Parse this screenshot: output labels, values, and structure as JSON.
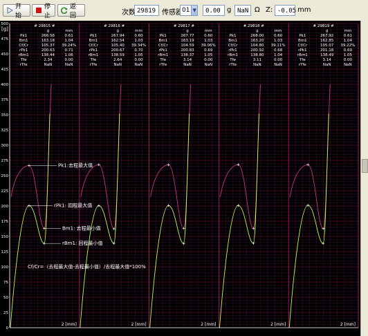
{
  "toolbar": {
    "start_label": "开始",
    "stop_label": "停止",
    "back_label": "返回",
    "count_label": "次数",
    "count_value": "29819",
    "sensor_label": "传感器",
    "sensor_value": "01",
    "force_value": "0.00",
    "force_unit": "g",
    "res_value": "NaN",
    "res_unit": "Ω",
    "z_label": "Z:",
    "z_value": "-0.05",
    "z_unit": "mm"
  },
  "axis": {
    "ylabel": "[g]",
    "yticks": [
      500,
      475,
      450,
      425,
      400,
      375,
      350,
      325,
      300,
      275,
      250,
      225,
      200,
      175,
      150,
      125,
      100,
      75,
      50,
      25,
      0
    ],
    "xlabel": "2 [mm]"
  },
  "panels": [
    {
      "id": "# 29815 #",
      "rows": [
        [
          "Pk1",
          "266.56",
          "0.61"
        ],
        [
          "Bm1",
          "163.18",
          "1.04"
        ],
        [
          "Cf/Cr",
          "105.37",
          "39.24%"
        ],
        [
          "rPk1",
          "200.63",
          "0.71"
        ],
        [
          "rBm1",
          "138.44",
          "1.06"
        ],
        [
          "Tfe",
          "2.34",
          "0.00"
        ],
        [
          "rTfe",
          "NaN",
          "NaN"
        ]
      ]
    },
    {
      "id": "# 29816 #",
      "rows": [
        [
          "Pk1",
          "267.94",
          "0.60"
        ],
        [
          "Bm1",
          "162.54",
          "1.03"
        ],
        [
          "Cf/Cr",
          "105.40",
          "39.34%"
        ],
        [
          "rPk1",
          "200.67",
          "0.70"
        ],
        [
          "rBm1",
          "138.59",
          "1.05"
        ],
        [
          "Tfe",
          "2.64",
          "0.00"
        ],
        [
          "rTfe",
          "NaN",
          "NaN"
        ]
      ]
    },
    {
      "id": "# 29817 #",
      "rows": [
        [
          "Pk1",
          "267.77",
          "0.60"
        ],
        [
          "Bm1",
          "163.19",
          "1.03"
        ],
        [
          "Cf/Cr",
          "104.59",
          "39.06%"
        ],
        [
          "rPk1",
          "200.83",
          "0.69"
        ],
        [
          "rBm1",
          "138.37",
          "1.05"
        ],
        [
          "Tfe",
          "3.14",
          "0.00"
        ],
        [
          "rTfe",
          "NaN",
          "NaN"
        ]
      ]
    },
    {
      "id": "# 29818 #",
      "rows": [
        [
          "Pk1",
          "268.00",
          "0.60"
        ],
        [
          "Bm1",
          "163.20",
          "1.03"
        ],
        [
          "Cf/Cr",
          "104.80",
          "39.11%"
        ],
        [
          "rPk1",
          "200.92",
          "0.68"
        ],
        [
          "rBm1",
          "138.80",
          "1.04"
        ],
        [
          "Tfe",
          "3.11",
          "0.00"
        ],
        [
          "rTfe",
          "NaN",
          "NaN"
        ]
      ]
    },
    {
      "id": "# 29819 #",
      "rows": [
        [
          "Pk1",
          "267.92",
          "0.61"
        ],
        [
          "Bm1",
          "162.85",
          "1.04"
        ],
        [
          "Cf/Cr",
          "105.07",
          "39.22%"
        ],
        [
          "rPk1",
          "201.18",
          "0.69"
        ],
        [
          "rBm1",
          "138.49",
          "1.05"
        ],
        [
          "Tfe",
          "3.14",
          "0.00"
        ],
        [
          "rTfe",
          "NaN",
          "NaN"
        ]
      ]
    }
  ],
  "stats_header": {
    "g": "g",
    "mm": "mm"
  },
  "annotations": {
    "pk": "Pk1:去程最大值",
    "rpk": "rPk1: 回程最大值",
    "bm": "Bm1: 去程最小值",
    "rbm": "rBm1: 回程最小值",
    "formula": "Cf/Cr=（去程最大值-去程最小值）/去程最大值*100%"
  },
  "colors": {
    "background": "#000000",
    "grid_major": "#c0196a",
    "grid_minor": "#3a1030",
    "forward_curve": "#c0387a",
    "return_curve": "#b8ff50",
    "text": "#ffffff"
  },
  "chart_data": {
    "type": "line",
    "ylabel": "[g]",
    "xlabel": "2 [mm]",
    "ylim": [
      0,
      500
    ],
    "series": [
      {
        "values": [
          266.56,
          163.18,
          200.63,
          138.44
        ]
      },
      {
        "values": [
          267.94,
          162.54,
          200.67,
          138.59
        ]
      },
      {
        "values": [
          267.77,
          163.19,
          200.83,
          138.37
        ]
      },
      {
        "values": [
          268.0,
          163.2,
          200.92,
          138.8
        ]
      },
      {
        "values": [
          267.92,
          162.85,
          201.18,
          138.49
        ]
      }
    ]
  }
}
